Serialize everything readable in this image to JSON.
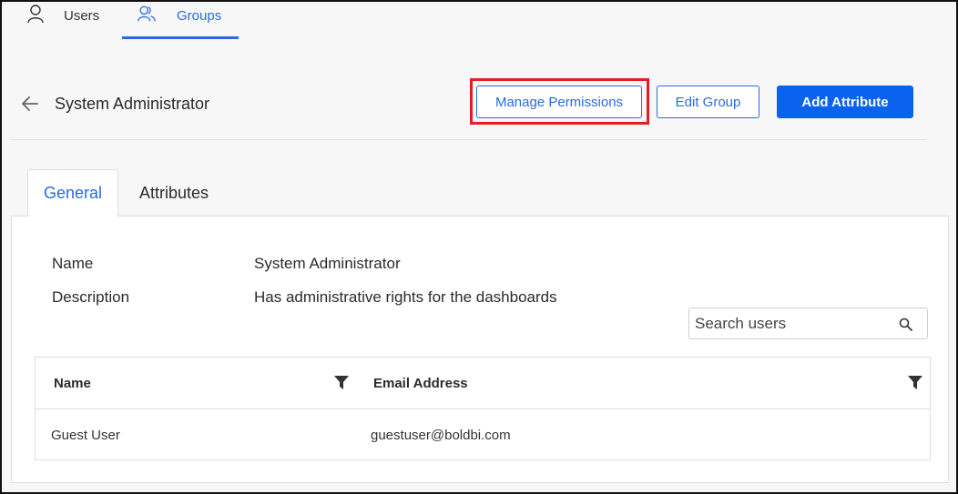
{
  "topnav": {
    "users_label": "Users",
    "groups_label": "Groups"
  },
  "header": {
    "title": "System Administrator",
    "buttons": {
      "manage_permissions": "Manage Permissions",
      "edit_group": "Edit Group",
      "add_attribute": "Add Attribute"
    }
  },
  "tabs": {
    "general": "General",
    "attributes": "Attributes"
  },
  "general": {
    "name_label": "Name",
    "name_value": "System Administrator",
    "description_label": "Description",
    "description_value": "Has administrative rights for the dashboards"
  },
  "search": {
    "placeholder": "Search users"
  },
  "grid": {
    "columns": [
      "Name",
      "Email Address"
    ],
    "rows": [
      {
        "name": "Guest User",
        "email": "guestuser@boldbi.com"
      }
    ]
  },
  "colors": {
    "accent": "#2a6ae0",
    "primary_button": "#0a63ee",
    "highlight": "#e41e25"
  },
  "icons": {
    "users": "user-icon",
    "groups": "group-icon",
    "back": "arrow-left-icon",
    "search": "search-icon",
    "filter": "filter-icon"
  }
}
